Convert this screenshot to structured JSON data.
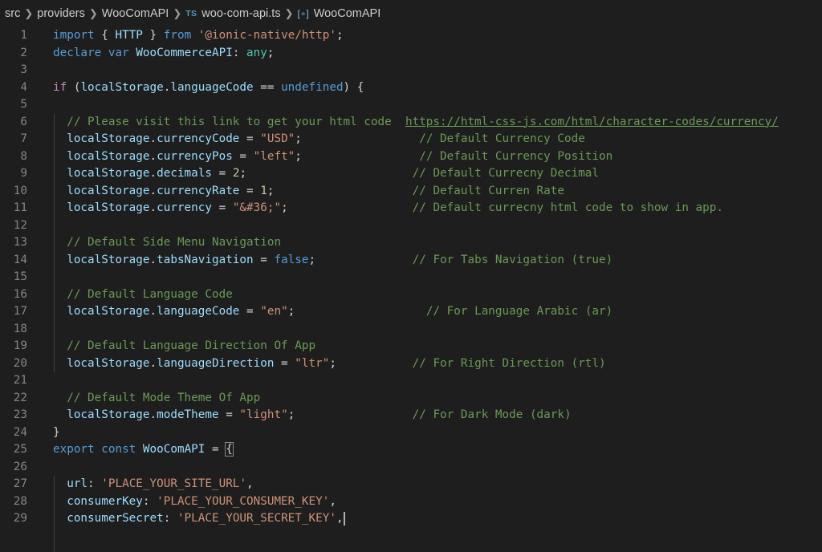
{
  "breadcrumb": {
    "items": [
      "src",
      "providers",
      "WooComAPI",
      "woo-com-api.ts",
      "WooComAPI"
    ],
    "file_badge": "TS",
    "symbol_icon": "symbol-variable-icon"
  },
  "editor": {
    "lines": [
      {
        "n": "1",
        "t": [
          [
            "kw",
            "import"
          ],
          [
            "p",
            " { "
          ],
          [
            "var",
            "HTTP"
          ],
          [
            "p",
            " } "
          ],
          [
            "kw",
            "from"
          ],
          [
            "p",
            " "
          ],
          [
            "str",
            "'@ionic-native/http'"
          ],
          [
            "p",
            ";"
          ]
        ]
      },
      {
        "n": "2",
        "t": [
          [
            "kw",
            "declare"
          ],
          [
            "p",
            " "
          ],
          [
            "kw",
            "var"
          ],
          [
            "p",
            " "
          ],
          [
            "var",
            "WooCommerceAPI"
          ],
          [
            "p",
            ": "
          ],
          [
            "cls",
            "any"
          ],
          [
            "p",
            ";"
          ]
        ]
      },
      {
        "n": "3",
        "t": []
      },
      {
        "n": "4",
        "t": [
          [
            "ctl",
            "if"
          ],
          [
            "p",
            " ("
          ],
          [
            "var",
            "localStorage"
          ],
          [
            "p",
            "."
          ],
          [
            "var",
            "languageCode"
          ],
          [
            "p",
            " == "
          ],
          [
            "kw",
            "undefined"
          ],
          [
            "p",
            ") {"
          ]
        ]
      },
      {
        "n": "5",
        "t": []
      },
      {
        "n": "6",
        "t": [
          [
            "p",
            "  "
          ],
          [
            "cm",
            "// Please visit this link to get your html code  "
          ],
          [
            "link",
            "https://html-css-js.com/html/character-codes/currency/"
          ]
        ]
      },
      {
        "n": "7",
        "t": [
          [
            "p",
            "  "
          ],
          [
            "var",
            "localStorage"
          ],
          [
            "p",
            "."
          ],
          [
            "var",
            "currencyCode"
          ],
          [
            "p",
            " = "
          ],
          [
            "str",
            "\"USD\""
          ],
          [
            "p",
            ";                 "
          ],
          [
            "cm",
            "// Default Currency Code"
          ]
        ]
      },
      {
        "n": "8",
        "t": [
          [
            "p",
            "  "
          ],
          [
            "var",
            "localStorage"
          ],
          [
            "p",
            "."
          ],
          [
            "var",
            "currencyPos"
          ],
          [
            "p",
            " = "
          ],
          [
            "str",
            "\"left\""
          ],
          [
            "p",
            ";                 "
          ],
          [
            "cm",
            "// Default Currency Position"
          ]
        ]
      },
      {
        "n": "9",
        "t": [
          [
            "p",
            "  "
          ],
          [
            "var",
            "localStorage"
          ],
          [
            "p",
            "."
          ],
          [
            "var",
            "decimals"
          ],
          [
            "p",
            " = "
          ],
          [
            "num",
            "2"
          ],
          [
            "p",
            ";                        "
          ],
          [
            "cm",
            "// Default Currecny Decimal"
          ]
        ]
      },
      {
        "n": "10",
        "t": [
          [
            "p",
            "  "
          ],
          [
            "var",
            "localStorage"
          ],
          [
            "p",
            "."
          ],
          [
            "var",
            "currencyRate"
          ],
          [
            "p",
            " = "
          ],
          [
            "num",
            "1"
          ],
          [
            "p",
            ";                    "
          ],
          [
            "cm",
            "// Default Curren Rate"
          ]
        ]
      },
      {
        "n": "11",
        "t": [
          [
            "p",
            "  "
          ],
          [
            "var",
            "localStorage"
          ],
          [
            "p",
            "."
          ],
          [
            "var",
            "currency"
          ],
          [
            "p",
            " = "
          ],
          [
            "str",
            "\"&#36;\""
          ],
          [
            "p",
            ";                  "
          ],
          [
            "cm",
            "// Default currecny html code to show in app."
          ]
        ]
      },
      {
        "n": "12",
        "t": []
      },
      {
        "n": "13",
        "t": [
          [
            "p",
            "  "
          ],
          [
            "cm",
            "// Default Side Menu Navigation"
          ]
        ]
      },
      {
        "n": "14",
        "t": [
          [
            "p",
            "  "
          ],
          [
            "var",
            "localStorage"
          ],
          [
            "p",
            "."
          ],
          [
            "var",
            "tabsNavigation"
          ],
          [
            "p",
            " = "
          ],
          [
            "kw",
            "false"
          ],
          [
            "p",
            ";              "
          ],
          [
            "cm",
            "// For Tabs Navigation (true)"
          ]
        ]
      },
      {
        "n": "15",
        "t": []
      },
      {
        "n": "16",
        "t": [
          [
            "p",
            "  "
          ],
          [
            "cm",
            "// Default Language Code"
          ]
        ]
      },
      {
        "n": "17",
        "t": [
          [
            "p",
            "  "
          ],
          [
            "var",
            "localStorage"
          ],
          [
            "p",
            "."
          ],
          [
            "var",
            "languageCode"
          ],
          [
            "p",
            " = "
          ],
          [
            "str",
            "\"en\""
          ],
          [
            "p",
            ";                   "
          ],
          [
            "cm",
            "// For Language Arabic (ar)"
          ]
        ]
      },
      {
        "n": "18",
        "t": []
      },
      {
        "n": "19",
        "t": [
          [
            "p",
            "  "
          ],
          [
            "cm",
            "// Default Language Direction Of App"
          ]
        ]
      },
      {
        "n": "20",
        "t": [
          [
            "p",
            "  "
          ],
          [
            "var",
            "localStorage"
          ],
          [
            "p",
            "."
          ],
          [
            "var",
            "languageDirection"
          ],
          [
            "p",
            " = "
          ],
          [
            "str",
            "\"ltr\""
          ],
          [
            "p",
            ";           "
          ],
          [
            "cm",
            "// For Right Direction (rtl)"
          ]
        ]
      },
      {
        "n": "21",
        "t": []
      },
      {
        "n": "22",
        "t": [
          [
            "p",
            "  "
          ],
          [
            "cm",
            "// Default Mode Theme Of App"
          ]
        ]
      },
      {
        "n": "23",
        "t": [
          [
            "p",
            "  "
          ],
          [
            "var",
            "localStorage"
          ],
          [
            "p",
            "."
          ],
          [
            "var",
            "modeTheme"
          ],
          [
            "p",
            " = "
          ],
          [
            "str",
            "\"light\""
          ],
          [
            "p",
            ";                 "
          ],
          [
            "cm",
            "// For Dark Mode (dark)"
          ]
        ]
      },
      {
        "n": "24",
        "t": [
          [
            "p",
            "}"
          ]
        ]
      },
      {
        "n": "25",
        "t": [
          [
            "kw",
            "export"
          ],
          [
            "p",
            " "
          ],
          [
            "kw",
            "const"
          ],
          [
            "p",
            " "
          ],
          [
            "var",
            "WooComAPI"
          ],
          [
            "p",
            " = "
          ],
          [
            "match",
            "{"
          ]
        ]
      },
      {
        "n": "26",
        "t": []
      },
      {
        "n": "27",
        "t": [
          [
            "p",
            "  "
          ],
          [
            "var",
            "url"
          ],
          [
            "p",
            ": "
          ],
          [
            "str",
            "'PLACE_YOUR_SITE_URL'"
          ],
          [
            "p",
            ","
          ]
        ]
      },
      {
        "n": "28",
        "t": [
          [
            "p",
            "  "
          ],
          [
            "var",
            "consumerKey"
          ],
          [
            "p",
            ": "
          ],
          [
            "str",
            "'PLACE_YOUR_CONSUMER_KEY'"
          ],
          [
            "p",
            ","
          ]
        ]
      },
      {
        "n": "29",
        "t": [
          [
            "p",
            "  "
          ],
          [
            "var",
            "consumerSecret"
          ],
          [
            "p",
            ": "
          ],
          [
            "str",
            "'PLACE_YOUR_SECRET_KEY'"
          ],
          [
            "p",
            ","
          ],
          [
            "cursor",
            ""
          ]
        ]
      }
    ]
  }
}
